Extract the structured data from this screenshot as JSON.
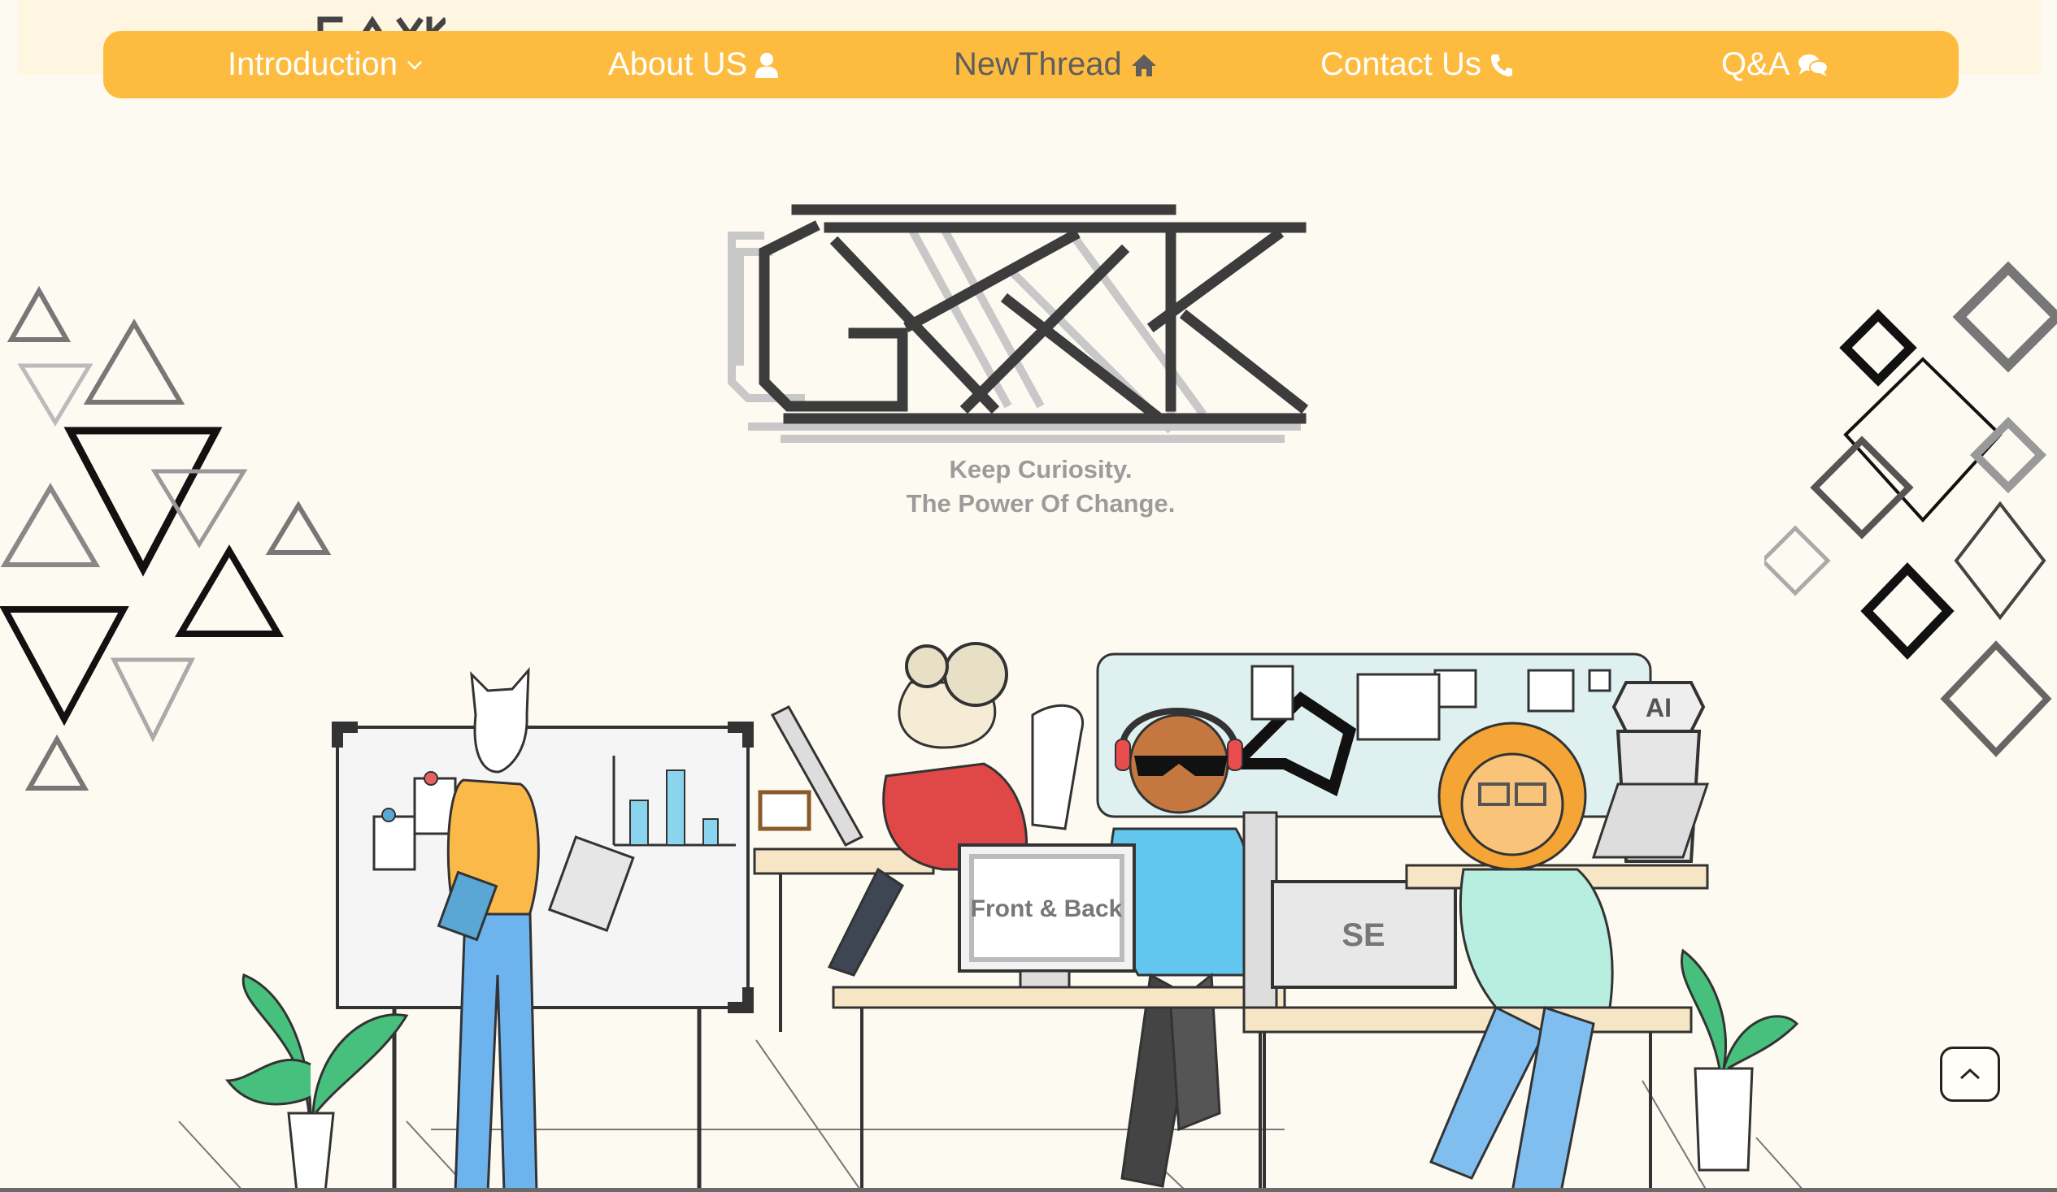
{
  "brand": {
    "logo_text": "GEEK"
  },
  "nav": {
    "items": [
      {
        "label": "Introduction",
        "icon": "chevron-down-icon"
      },
      {
        "label": "About US",
        "icon": "user-icon"
      },
      {
        "label": "NewThread",
        "icon": "home-icon",
        "active": true
      },
      {
        "label": "Contact Us",
        "icon": "phone-icon"
      },
      {
        "label": "Q&A",
        "icon": "chat-bubbles-icon"
      }
    ]
  },
  "hero": {
    "tagline_line1": "Keep Curiosity.",
    "tagline_line2": "The Power Of Change."
  },
  "illustration": {
    "monitor_label": "Front & Back",
    "monitor2_label": "SE",
    "badge_label": "AI"
  },
  "colors": {
    "navbar": "#fdbc3f",
    "background": "#fdfaf1",
    "active_nav_text": "#5e5e5e",
    "tagline": "#9b9b9b"
  },
  "scroll_top": {
    "icon": "chevron-up-icon"
  }
}
